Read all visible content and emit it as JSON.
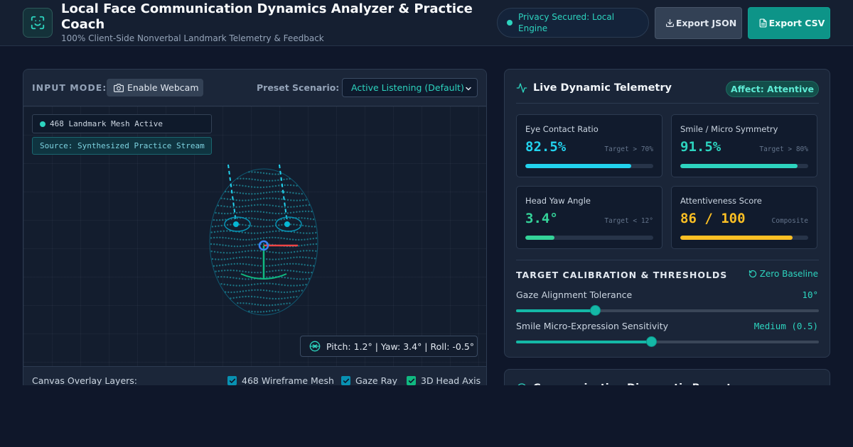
{
  "header": {
    "title": "Local Face Communication Dynamics Analyzer & Practice Coach",
    "subtitle": "100% Client-Side Nonverbal Landmark Telemetry & Feedback",
    "privacy": "Privacy Secured: Local Engine",
    "export_json": "Export JSON",
    "export_csv": "Export CSV"
  },
  "input": {
    "mode_label": "INPUT MODE:",
    "webcam_button": "Enable Webcam",
    "preset_label": "Preset Scenario:",
    "preset_value": "Active Listening (Default)"
  },
  "canvas": {
    "mesh_status": "468 Landmark Mesh Active",
    "source": "Source: Synthesized Practice Stream",
    "pose": "Pitch: 1.2° | Yaw: 3.4° | Roll: -0.5°"
  },
  "overlays": {
    "label": "Canvas Overlay Layers:",
    "items": [
      {
        "label": "468 Wireframe Mesh",
        "checked": true,
        "color": "#0891b2"
      },
      {
        "label": "Gaze Ray",
        "checked": true,
        "color": "#0891b2"
      },
      {
        "label": "3D Head Axis",
        "checked": true,
        "color": "#10b981"
      }
    ]
  },
  "telemetry": {
    "title": "Live Dynamic Telemetry",
    "affect": "Affect: Attentive",
    "metrics": [
      {
        "label": "Eye Contact Ratio",
        "value": "82.5%",
        "target": "Target > 70%",
        "fill": 0.825,
        "color": "#22d3ee"
      },
      {
        "label": "Smile / Micro Symmetry",
        "value": "91.5%",
        "target": "Target > 80%",
        "fill": 0.915,
        "color": "#2dd4bf"
      },
      {
        "label": "Head Yaw Angle",
        "value": "3.4°",
        "target": "Target < 12°",
        "fill": 0.23,
        "color": "#34d399"
      },
      {
        "label": "Attentiveness Score",
        "value": "86 / 100",
        "target": "Composite",
        "fill": 0.88,
        "color": "#fbbf24"
      }
    ]
  },
  "calibration": {
    "title": "TARGET CALIBRATION & THRESHOLDS",
    "zero_button": "Zero Baseline",
    "sliders": [
      {
        "label": "Gaze Alignment Tolerance",
        "value": "10°",
        "fraction": 0.26
      },
      {
        "label": "Smile Micro-Expression Sensitivity",
        "value": "Medium (0.5)",
        "fraction": 0.445
      }
    ]
  },
  "diagnostic": {
    "title": "Communication Diagnostic Report"
  },
  "colors": {
    "accent": "#2dd4bf",
    "background": "#0f172a",
    "panel": "#1a2538"
  }
}
